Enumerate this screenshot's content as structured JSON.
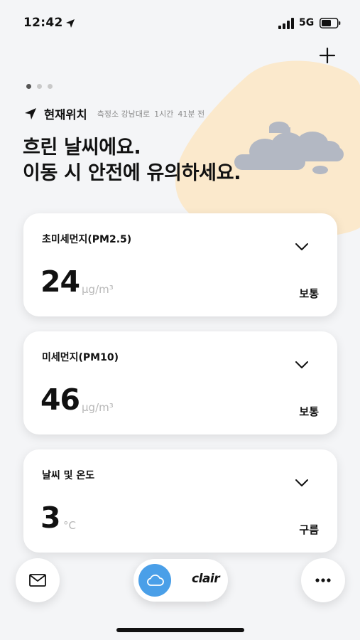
{
  "status_bar": {
    "time": "12:42",
    "network": "5G"
  },
  "location": {
    "label": "현재위치",
    "station": "측정소 강남대로",
    "time_ago_1": "1시간",
    "time_ago_2": "41분 전"
  },
  "headline": {
    "line1": "흐린 날씨에요.",
    "line2": "이동 시 안전에 유의하세요."
  },
  "page_dots": {
    "count": 3,
    "active": 0
  },
  "cards": [
    {
      "title": "초미세먼지(PM2.5)",
      "value": "24",
      "unit": "μg/m³",
      "status": "보통"
    },
    {
      "title": "미세먼지(PM10)",
      "value": "46",
      "unit": "μg/m³",
      "status": "보통"
    },
    {
      "title": "날씨 및 온도",
      "value": "3",
      "unit": "°C",
      "status": "구름"
    }
  ],
  "bottom_bar": {
    "logo": "clair"
  },
  "colors": {
    "accent": "#4a9fe8",
    "blob": "#fbe9cc",
    "cloud": "#b3b8c3"
  }
}
